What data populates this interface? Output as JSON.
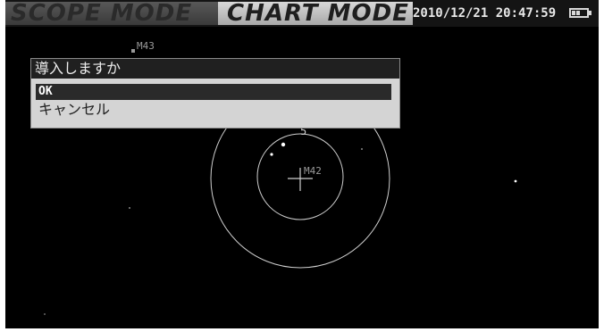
{
  "top_bar": {
    "tabs": [
      {
        "label": "SCOPE MODE",
        "active": false
      },
      {
        "label": "CHART MODE",
        "active": true
      }
    ],
    "datetime": "2010/12/21 20:47:59",
    "battery_icon": "battery-icon",
    "battery_level": 0.8
  },
  "dialog": {
    "title": "導入しますか",
    "options": [
      {
        "label": "OK",
        "selected": true
      },
      {
        "label": "キャンセル",
        "selected": false
      }
    ]
  },
  "chart": {
    "labels": {
      "upper_object": "M43",
      "target_object": "M42",
      "circle_marker": "5"
    },
    "crosshair_icon": "crosshair-icon"
  },
  "colors": {
    "background": "#000000",
    "circle": "#cfcfcf",
    "dialog_title_bg": "#202020",
    "dialog_body_bg": "#d4d4d4",
    "selection_bg": "#2a2a2a"
  }
}
